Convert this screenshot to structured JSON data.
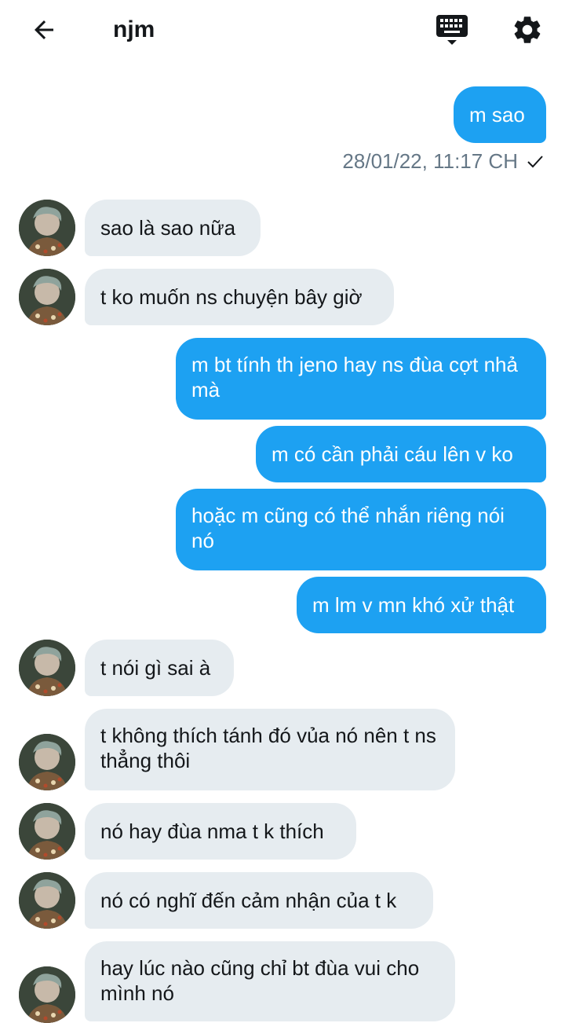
{
  "header": {
    "title": "njm",
    "back_icon": "arrow-left-icon",
    "keyboard_icon": "keyboard-icon",
    "settings_icon": "gear-icon"
  },
  "colors": {
    "outgoing_bubble": "#1da1f2",
    "incoming_bubble": "#e6ecf0",
    "meta_text": "#657786"
  },
  "messages": [
    {
      "from": "me",
      "text": "m sao"
    },
    {
      "from": "them",
      "text": "sao là sao nữa"
    },
    {
      "from": "them",
      "text": "t ko muốn ns chuyện bây giờ"
    },
    {
      "from": "me",
      "text": "m bt tính th jeno hay ns đùa cợt nhả mà"
    },
    {
      "from": "me",
      "text": "m có cần phải cáu lên v ko"
    },
    {
      "from": "me",
      "text": "hoặc m cũng có thể nhắn riêng nói nó"
    },
    {
      "from": "me",
      "text": "m lm v mn khó xử thật"
    },
    {
      "from": "them",
      "text": "t nói gì sai à"
    },
    {
      "from": "them",
      "text": "t không thích tánh đó vủa nó nên t ns thẳng thôi"
    },
    {
      "from": "them",
      "text": "nó hay đùa nma t k thích"
    },
    {
      "from": "them",
      "text": "nó có nghĩ đến cảm nhận của t k"
    },
    {
      "from": "them",
      "text": "hay lúc nào cũng chỉ bt đùa vui cho mình nó"
    }
  ],
  "first_message_meta": {
    "timestamp": "28/01/22, 11:17 CH",
    "status_icon": "checkmark-icon"
  }
}
